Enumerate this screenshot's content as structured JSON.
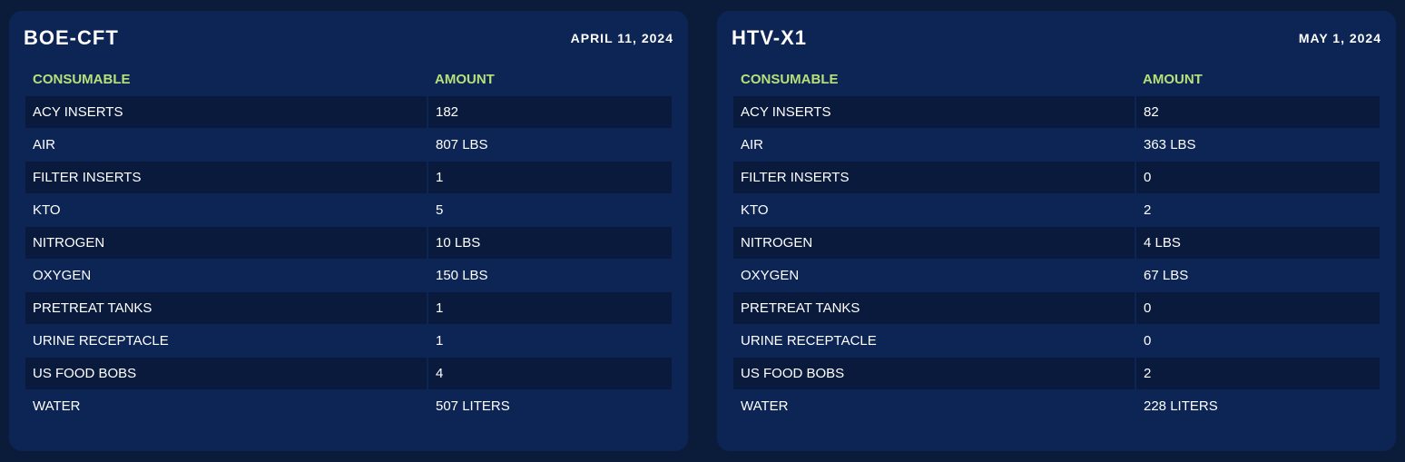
{
  "missions": [
    {
      "name": "BOE-CFT",
      "date": "APRIL 11, 2024",
      "columns": [
        "CONSUMABLE",
        "AMOUNT"
      ],
      "rows": [
        [
          "ACY INSERTS",
          "182"
        ],
        [
          "AIR",
          "807 LBS"
        ],
        [
          "FILTER INSERTS",
          "1"
        ],
        [
          "KTO",
          "5"
        ],
        [
          "NITROGEN",
          "10 LBS"
        ],
        [
          "OXYGEN",
          "150 LBS"
        ],
        [
          "PRETREAT TANKS",
          "1"
        ],
        [
          "URINE RECEPTACLE",
          "1"
        ],
        [
          "US FOOD BOBS",
          "4"
        ],
        [
          "WATER",
          "507 LITERS"
        ]
      ]
    },
    {
      "name": "HTV-X1",
      "date": "MAY 1, 2024",
      "columns": [
        "CONSUMABLE",
        "AMOUNT"
      ],
      "rows": [
        [
          "ACY INSERTS",
          "82"
        ],
        [
          "AIR",
          "363 LBS"
        ],
        [
          "FILTER INSERTS",
          "0"
        ],
        [
          "KTO",
          "2"
        ],
        [
          "NITROGEN",
          "4 LBS"
        ],
        [
          "OXYGEN",
          "67 LBS"
        ],
        [
          "PRETREAT TANKS",
          "0"
        ],
        [
          "URINE RECEPTACLE",
          "0"
        ],
        [
          "US FOOD BOBS",
          "2"
        ],
        [
          "WATER",
          "228 LITERS"
        ]
      ]
    }
  ],
  "colors": {
    "page_background": "#0b1c3b",
    "card_background": "#0c2554",
    "stripe_row": "#0a1a3d",
    "header_text": "#b8e07a",
    "text": "#ffffff"
  }
}
